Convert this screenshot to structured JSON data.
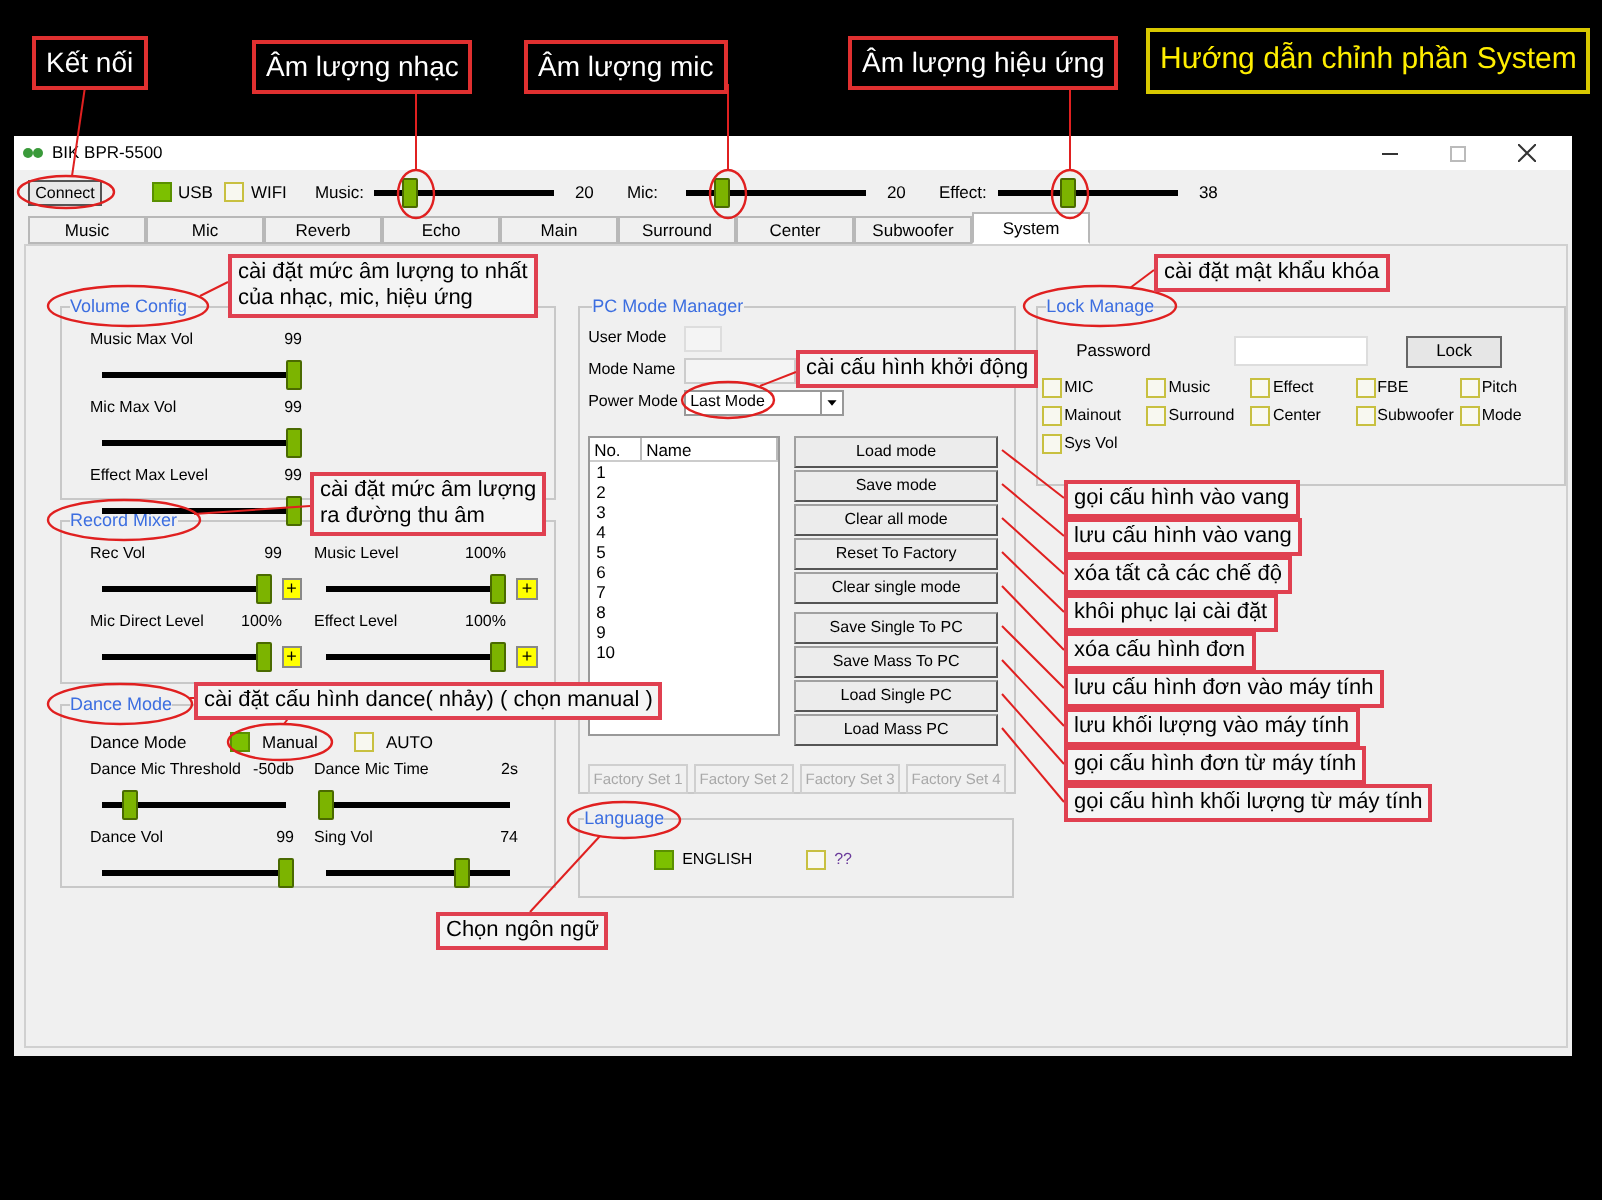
{
  "annotations": [
    {
      "kind": "label",
      "lines": [
        "Kết nối"
      ]
    },
    {
      "kind": "label",
      "lines": [
        "Âm lượng nhạc"
      ]
    },
    {
      "kind": "label",
      "lines": [
        "Âm lượng mic"
      ]
    },
    {
      "kind": "label",
      "lines": [
        "Âm lượng hiệu ứng"
      ]
    },
    {
      "kind": "title",
      "lines": [
        "Hướng dẫn chỉnh phần System"
      ]
    },
    {
      "kind": "callout",
      "lines": [
        "cài đặt mức âm lượng to nhất",
        "của nhạc, mic, hiệu ứng"
      ]
    },
    {
      "kind": "callout",
      "lines": [
        "cài đặt mức âm lượng",
        "ra đường thu âm"
      ]
    },
    {
      "kind": "callout",
      "lines": [
        "cài đặt cấu hình dance( nhảy) ( chọn manual )"
      ]
    },
    {
      "kind": "callout",
      "lines": [
        "Chọn ngôn ngữ"
      ]
    },
    {
      "kind": "callout",
      "lines": [
        "cài cấu hình khởi động"
      ]
    },
    {
      "kind": "callout",
      "lines": [
        "cài đặt mật khẩu khóa"
      ]
    },
    {
      "kind": "callout",
      "lines": [
        "gọi cấu hình vào vang"
      ]
    },
    {
      "kind": "callout",
      "lines": [
        "lưu cấu hình vào vang"
      ]
    },
    {
      "kind": "callout",
      "lines": [
        "xóa tất cả các chế độ"
      ]
    },
    {
      "kind": "callout",
      "lines": [
        "khôi phục lại cài đặt"
      ]
    },
    {
      "kind": "callout",
      "lines": [
        "xóa cấu hình đơn"
      ]
    },
    {
      "kind": "callout",
      "lines": [
        "lưu cấu hình đơn vào máy tính"
      ]
    },
    {
      "kind": "callout",
      "lines": [
        "lưu khối lượng vào máy tính"
      ]
    },
    {
      "kind": "callout",
      "lines": [
        "gọi cấu hình đơn từ máy tính"
      ]
    },
    {
      "kind": "callout",
      "lines": [
        "gọi cấu hình khối lượng từ máy tính"
      ]
    }
  ],
  "window": {
    "title": "BIK BPR-5500"
  },
  "toolbar": {
    "connect": "Connect",
    "links": [
      {
        "label": "USB",
        "checked": true
      },
      {
        "label": "WIFI",
        "checked": false
      }
    ],
    "sliders": [
      {
        "label": "Music:",
        "value": "20",
        "level": 0.2
      },
      {
        "label": "Mic:",
        "value": "20",
        "level": 0.2
      },
      {
        "label": "Effect:",
        "value": "38",
        "level": 0.38
      }
    ]
  },
  "tabs": [
    {
      "label": "Music",
      "selected": false
    },
    {
      "label": "Mic",
      "selected": false
    },
    {
      "label": "Reverb",
      "selected": false
    },
    {
      "label": "Echo",
      "selected": false
    },
    {
      "label": "Main",
      "selected": false
    },
    {
      "label": "Surround",
      "selected": false
    },
    {
      "label": "Center",
      "selected": false
    },
    {
      "label": "Subwoofer",
      "selected": false
    },
    {
      "label": "System",
      "selected": true
    }
  ],
  "volume_config": {
    "title": "Volume Config",
    "sliders": [
      {
        "label": "Music Max Vol",
        "value": "99",
        "level": 1
      },
      {
        "label": "Mic Max Vol",
        "value": "99",
        "level": 1
      },
      {
        "label": "Effect Max Level",
        "value": "99",
        "level": 1
      }
    ]
  },
  "record_mixer": {
    "title": "Record Mixer",
    "sliders": [
      {
        "label": "Rec Vol",
        "value": "99",
        "level": 1,
        "plus": "+"
      },
      {
        "label": "Music Level",
        "value": "100%",
        "level": 1,
        "plus": "+"
      },
      {
        "label": "Mic Direct Level",
        "value": "100%",
        "level": 1,
        "plus": "+"
      },
      {
        "label": "Effect Level",
        "value": "100%",
        "level": 1,
        "plus": "+"
      }
    ]
  },
  "dance_mode": {
    "title": "Dance Mode",
    "mode_label": "Dance Mode",
    "options": [
      {
        "label": "Manual",
        "checked": true
      },
      {
        "label": "AUTO",
        "checked": false
      }
    ],
    "sliders": [
      {
        "label": "Dance Mic Threshold",
        "value": "-50db",
        "level": 0.15
      },
      {
        "label": "Dance Mic Time",
        "value": "2s",
        "level": 0
      },
      {
        "label": "Dance Vol",
        "value": "99",
        "level": 1
      },
      {
        "label": "Sing Vol",
        "value": "74",
        "level": 0.74
      }
    ]
  },
  "pc_mode_manager": {
    "title": "PC Mode Manager",
    "user_mode_label": "User Mode",
    "mode_name_label": "Mode Name",
    "power_mode_label": "Power Mode",
    "power_mode_value": "Last Mode",
    "table": {
      "columns": [
        "No.",
        "Name"
      ],
      "rows": [
        "1",
        "2",
        "3",
        "4",
        "5",
        "6",
        "7",
        "8",
        "9",
        "10"
      ]
    },
    "buttons": [
      "Load mode",
      "Save mode",
      "Clear all mode",
      "Reset To Factory",
      "Clear single mode",
      "Save Single To PC",
      "Save Mass To PC",
      "Load Single PC",
      "Load Mass PC"
    ],
    "factory_buttons": [
      {
        "label": "Factory Set 1",
        "disabled": true
      },
      {
        "label": "Factory Set 2",
        "disabled": true
      },
      {
        "label": "Factory Set 3",
        "disabled": true
      },
      {
        "label": "Factory Set 4",
        "disabled": true
      }
    ]
  },
  "language": {
    "title": "Language",
    "options": [
      {
        "label": "ENGLISH",
        "checked": true
      },
      {
        "label": "??",
        "checked": false
      }
    ]
  },
  "lock_manage": {
    "title": "Lock Manage",
    "password_label": "Password",
    "lock_button": "Lock",
    "options": [
      {
        "label": "MIC",
        "checked": false
      },
      {
        "label": "Music",
        "checked": false
      },
      {
        "label": "Effect",
        "checked": false
      },
      {
        "label": "FBE",
        "checked": false
      },
      {
        "label": "Pitch",
        "checked": false
      },
      {
        "label": "Mainout",
        "checked": false
      },
      {
        "label": "Surround",
        "checked": false
      },
      {
        "label": "Center",
        "checked": false
      },
      {
        "label": "Subwoofer",
        "checked": false
      },
      {
        "label": "Mode",
        "checked": false
      },
      {
        "label": "Sys Vol",
        "checked": false
      }
    ]
  }
}
